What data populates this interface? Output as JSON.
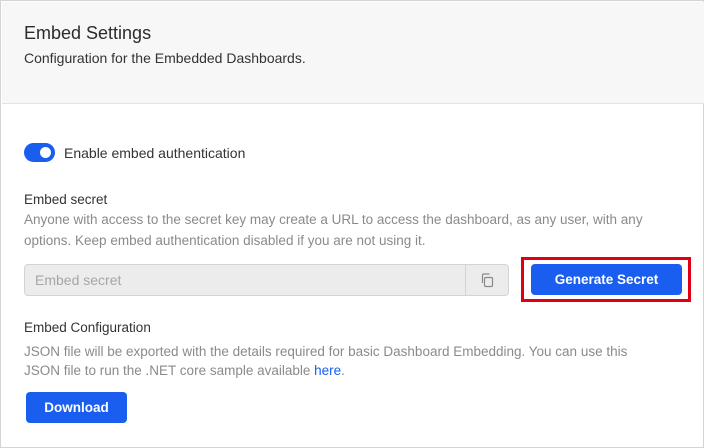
{
  "header": {
    "title": "Embed Settings",
    "subtitle": "Configuration for the Embedded Dashboards."
  },
  "auth": {
    "toggle_enabled": true,
    "toggle_label": "Enable embed authentication"
  },
  "secret": {
    "label": "Embed secret",
    "help_line_1": "Anyone with access to the secret key may create a URL to access the dashboard, as any user, with any",
    "help_line_2": "options. Keep embed authentication disabled if you are not using it.",
    "placeholder": "Embed secret",
    "value": "",
    "copy_icon": "copy-icon",
    "generate_label": "Generate Secret"
  },
  "config": {
    "label": "Embed Configuration",
    "help_line_1": "JSON file will be exported with the details required for basic Dashboard Embedding. You can use this",
    "help_line_2_prefix": "JSON file to run the .NET core sample available ",
    "help_link": "here",
    "help_line_2_suffix": ".",
    "download_label": "Download"
  },
  "colors": {
    "accent": "#1a5ef0",
    "highlight": "#e00012",
    "header_bg": "#f7f7f7"
  }
}
